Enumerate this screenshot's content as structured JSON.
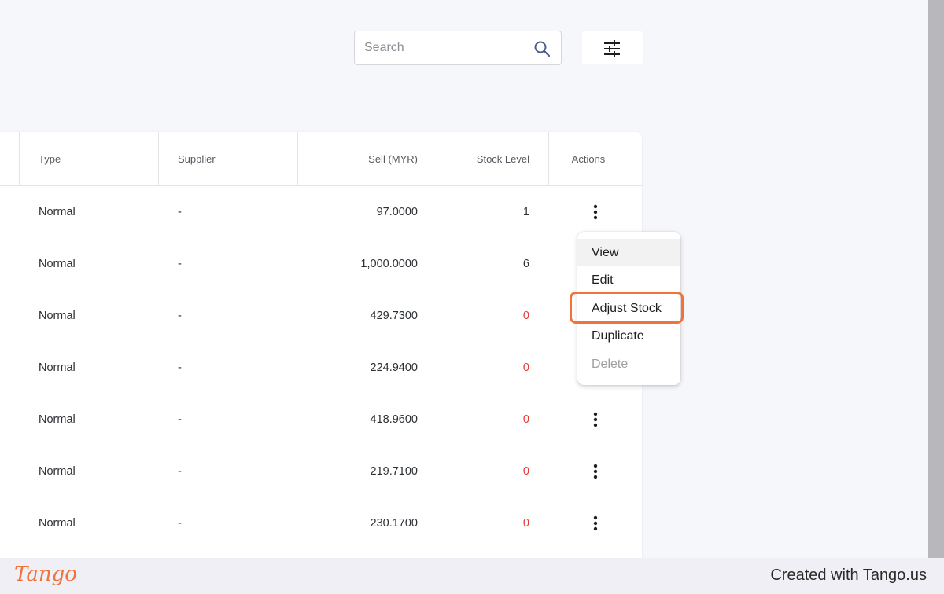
{
  "search": {
    "placeholder": "Search",
    "value": ""
  },
  "table": {
    "columns": {
      "type": "Type",
      "supplier": "Supplier",
      "sell": "Sell (MYR)",
      "stock": "Stock Level",
      "actions": "Actions"
    },
    "rows": [
      {
        "type": "Normal",
        "supplier": "-",
        "sell": "97.0000",
        "stock": "1"
      },
      {
        "type": "Normal",
        "supplier": "-",
        "sell": "1,000.0000",
        "stock": "6"
      },
      {
        "type": "Normal",
        "supplier": "-",
        "sell": "429.7300",
        "stock": "0"
      },
      {
        "type": "Normal",
        "supplier": "-",
        "sell": "224.9400",
        "stock": "0"
      },
      {
        "type": "Normal",
        "supplier": "-",
        "sell": "418.9600",
        "stock": "0"
      },
      {
        "type": "Normal",
        "supplier": "-",
        "sell": "219.7100",
        "stock": "0"
      },
      {
        "type": "Normal",
        "supplier": "-",
        "sell": "230.1700",
        "stock": "0"
      }
    ]
  },
  "menu": {
    "items": [
      "View",
      "Edit",
      "Adjust Stock",
      "Duplicate",
      "Delete"
    ]
  },
  "footer": {
    "logo": "Tango",
    "text": "Created with Tango.us"
  },
  "colors": {
    "zero_stock": "#e53935",
    "highlight": "#f0733a",
    "background": "#f6f7fb"
  }
}
